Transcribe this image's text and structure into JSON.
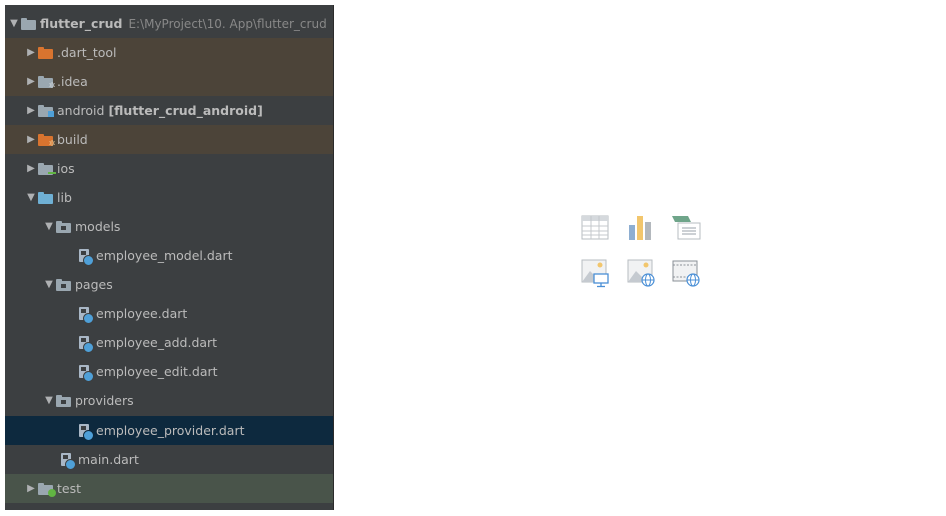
{
  "project_tree": {
    "root": {
      "name": "flutter_crud",
      "path": "E:\\MyProject\\10. App\\flutter_crud",
      "expanded": true
    },
    "rows": [
      {
        "label": ".dart_tool",
        "kind": "excluded",
        "expanded": false
      },
      {
        "label": ".idea",
        "kind": "config",
        "expanded": false
      },
      {
        "label": "android",
        "module": "[flutter_crud_android]",
        "kind": "module",
        "expanded": false
      },
      {
        "label": "build",
        "kind": "excluded",
        "expanded": false
      },
      {
        "label": "ios",
        "kind": "folder",
        "expanded": false
      },
      {
        "label": "lib",
        "kind": "source",
        "expanded": true
      },
      {
        "label": "models",
        "kind": "package",
        "expanded": true
      },
      {
        "label": "employee_model.dart",
        "kind": "dart"
      },
      {
        "label": "pages",
        "kind": "package",
        "expanded": true
      },
      {
        "label": "employee.dart",
        "kind": "dart"
      },
      {
        "label": "employee_add.dart",
        "kind": "dart"
      },
      {
        "label": "employee_edit.dart",
        "kind": "dart"
      },
      {
        "label": "providers",
        "kind": "package",
        "expanded": true
      },
      {
        "label": "employee_provider.dart",
        "kind": "dart",
        "selected": true
      },
      {
        "label": "main.dart",
        "kind": "dart"
      },
      {
        "label": "test",
        "kind": "test",
        "expanded": false
      }
    ]
  },
  "empty_state": {
    "icons": [
      "table-icon",
      "bar-chart-icon",
      "list-view-icon",
      "image-display-icon",
      "image-web-icon",
      "video-web-icon"
    ]
  },
  "colors": {
    "panel_bg": "#3c3f41",
    "excluded_bg": "#4c4439",
    "selected_bg": "#0d293e",
    "test_bg": "#49544a",
    "text": "#bbbbbb",
    "path_text": "#888888"
  }
}
